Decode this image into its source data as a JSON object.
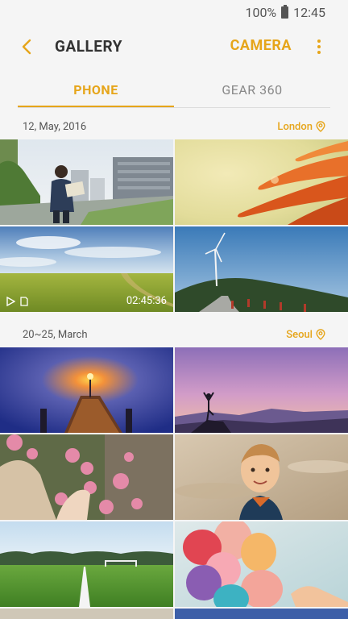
{
  "status": {
    "battery": "100%",
    "time": "12:45"
  },
  "header": {
    "title": "GALLERY",
    "camera_label": "CAMERA"
  },
  "tabs": [
    {
      "label": "PHONE"
    },
    {
      "label": "GEAR 360"
    }
  ],
  "sections": [
    {
      "date": "12, May, 2016",
      "location": "London",
      "items": [
        {
          "subject": "man reading map in street"
        },
        {
          "subject": "orange flower petals"
        },
        {
          "subject": "green field under sky",
          "video_duration": "02:45:36"
        },
        {
          "subject": "wind turbine on hill"
        }
      ]
    },
    {
      "date": "20~25, March",
      "location": "Seoul",
      "items": [
        {
          "subject": "pier with lamp at dusk"
        },
        {
          "subject": "yoga silhouette on mountain"
        },
        {
          "subject": "hand with pink flowers"
        },
        {
          "subject": "smiling boy"
        },
        {
          "subject": "soccer field"
        },
        {
          "subject": "colorful balloons"
        }
      ]
    }
  ],
  "colors": {
    "accent": "#e6a51a",
    "background": "#f5f5f5"
  }
}
